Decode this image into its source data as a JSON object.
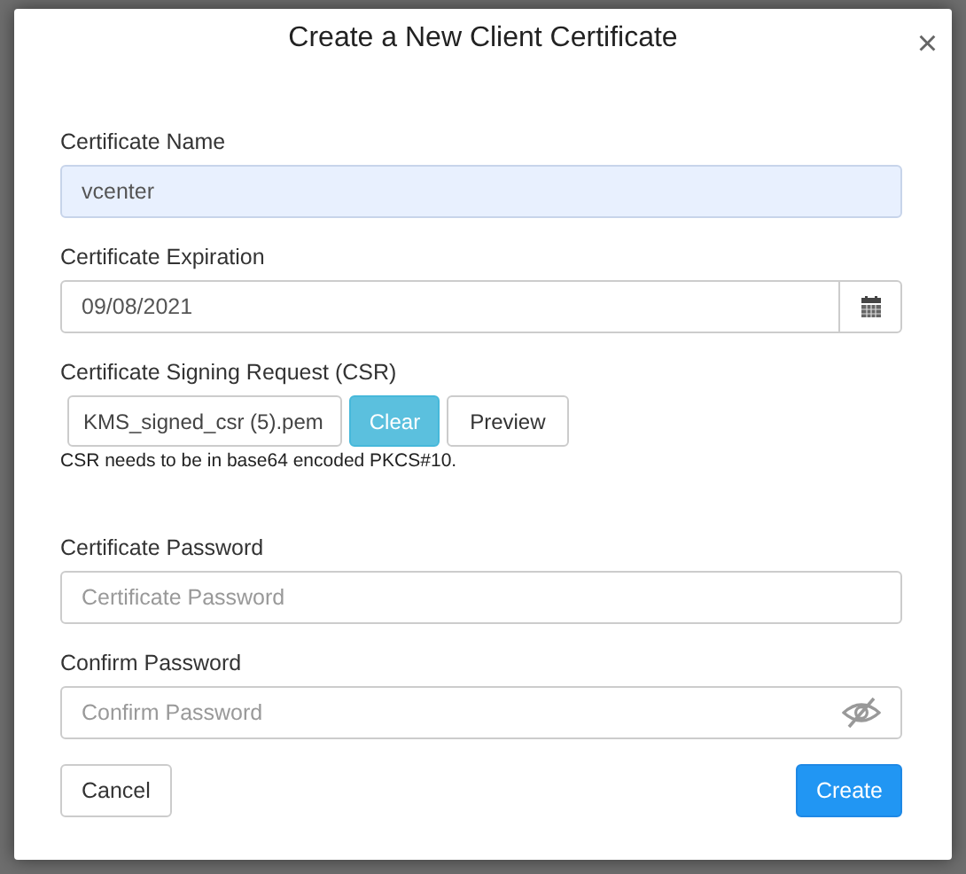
{
  "dialog": {
    "title": "Create a New Client Certificate",
    "close": "×"
  },
  "fields": [
    {
      "kind": "text",
      "label": "Certificate Name",
      "value": "vcenter",
      "highlighted": true
    },
    {
      "kind": "date",
      "label": "Certificate Expiration",
      "value": "09/08/2021"
    },
    {
      "kind": "file",
      "label": "Certificate Signing Request (CSR)",
      "value": "KMS_signed_csr (5).pem",
      "buttons": [
        "Clear",
        "Preview"
      ],
      "hint": "CSR needs to be in base64 encoded PKCS#10."
    },
    {
      "kind": "password",
      "label": "Certificate Password",
      "placeholder": "Certificate Password",
      "reveal_icon": false
    },
    {
      "kind": "password",
      "label": "Confirm Password",
      "placeholder": "Confirm Password",
      "reveal_icon": true
    }
  ],
  "buttons": {
    "cancel": "Cancel",
    "create": "Create"
  }
}
